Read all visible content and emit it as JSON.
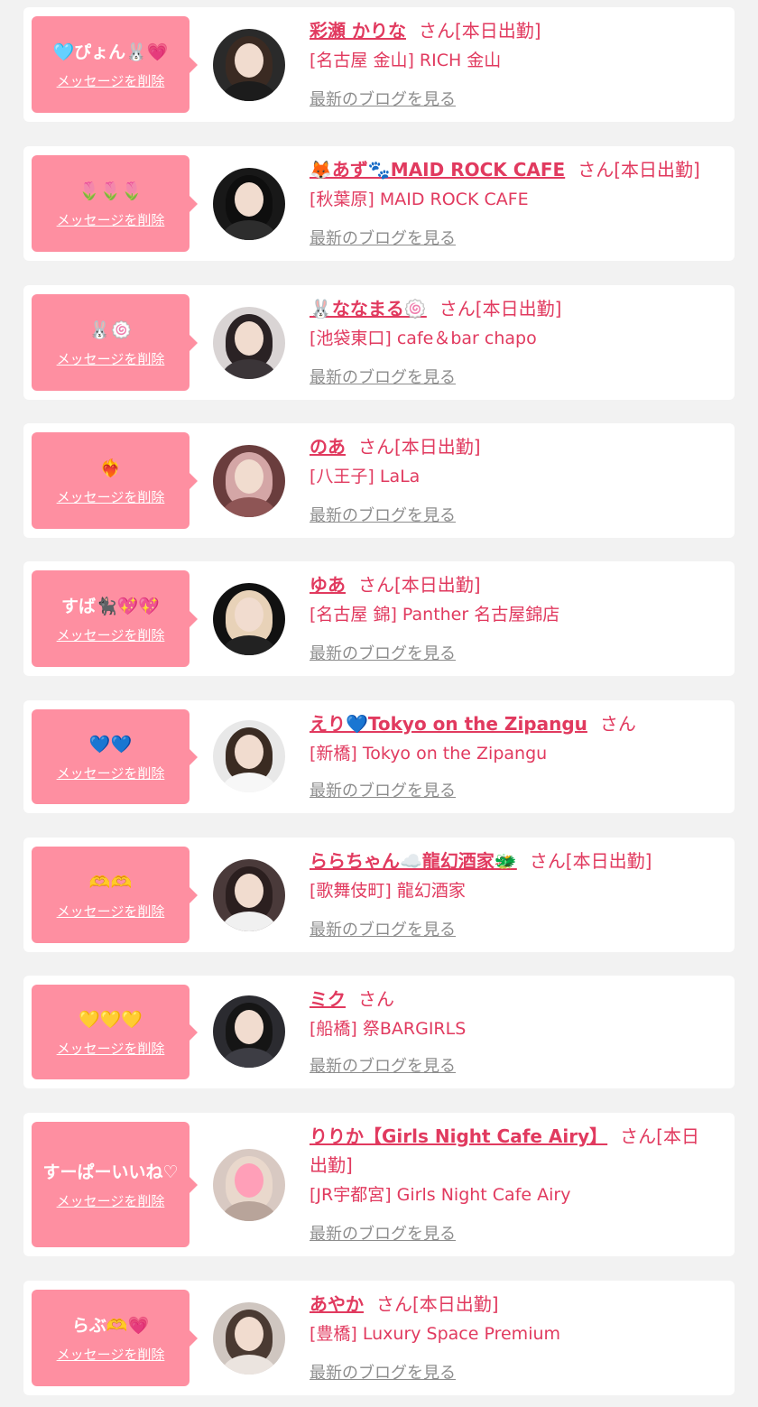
{
  "common": {
    "delete_label": "メッセージを削除",
    "blog_label": "最新のブログを見る"
  },
  "items": [
    {
      "message": "🩵ぴょん🐰💗",
      "name": "彩瀬 かりな",
      "suffix": "さん[本日出勤]",
      "shop": "[名古屋 金山] RICH 金山"
    },
    {
      "message": "🌷🌷🌷",
      "name": "🦊あず🐾MAID ROCK CAFE",
      "suffix": "さん[本日出勤]",
      "shop": "[秋葉原] MAID ROCK CAFE"
    },
    {
      "message": "🐰🍥",
      "name": "🐰ななまる🍥",
      "suffix": "さん[本日出勤]",
      "shop": "[池袋東口] cafe＆bar chapo"
    },
    {
      "message": "❤️‍🔥",
      "name": "のあ",
      "suffix": "さん[本日出勤]",
      "shop": "[八王子] LaLa"
    },
    {
      "message": "すば🐈‍⬛💖💖",
      "name": "ゆあ",
      "suffix": "さん[本日出勤]",
      "shop": "[名古屋 錦] Panther 名古屋錦店"
    },
    {
      "message": "💙💙",
      "name": "えり💙Tokyo on the Zipangu",
      "suffix": "さん",
      "shop": "[新橋] Tokyo on the Zipangu"
    },
    {
      "message": "🫶🫶",
      "name": "ららちゃん☁️龍幻酒家🐲",
      "suffix": "さん[本日出勤]",
      "shop": "[歌舞伎町] 龍幻酒家"
    },
    {
      "message": "💛💛💛",
      "name": "ミク",
      "suffix": "さん",
      "shop": "[船橋] 祭BARGIRLS"
    },
    {
      "message": "すーぱーいいね♡",
      "name": "りりか【Girls Night Cafe Airy】",
      "suffix": "さん[本日出勤]",
      "shop": "[JR宇都宮] Girls Night Cafe Airy"
    },
    {
      "message": "らぶ🫶💗",
      "name": "あやか",
      "suffix": "さん[本日出勤]",
      "shop": "[豊橋] Luxury Space Premium"
    }
  ],
  "avatar_icon": "person-photo",
  "colors": {
    "accent": "#e13a5f",
    "bubble": "#fe8fa1",
    "link_gray": "#8d8d8d",
    "background": "#f2f2f2"
  }
}
